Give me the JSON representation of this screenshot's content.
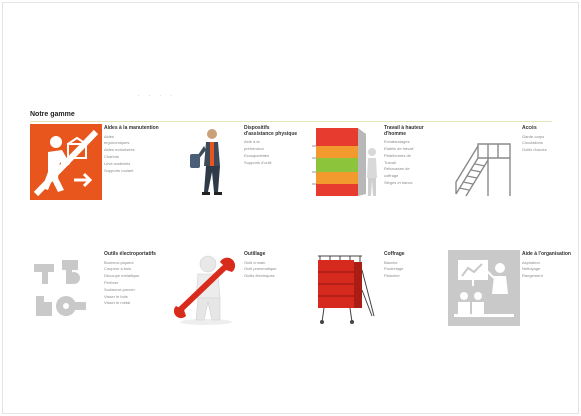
{
  "heading": "Notre gamme",
  "dots": ". . . .",
  "colors": {
    "accent": "#e8561e",
    "rule": "#e3e6b8",
    "grey_tile": "#c9c9c9"
  },
  "categories": [
    {
      "title": "Aides à la manutention",
      "icon": "porter-carrying-box-icon",
      "links": [
        "Aides",
        "ergonomiques",
        "Aides motorisées",
        "Chariots",
        "Lève-matériels",
        "Supports roulant"
      ]
    },
    {
      "title": "Dispositifs d'assistance physique",
      "icon": "worker-exoskeleton-icon",
      "links": [
        "Aide à la",
        "préhension",
        "Exosquelettes",
        "Supports d'outil"
      ]
    },
    {
      "title": "Travail à hauteur d'homme",
      "icon": "height-zones-wall-icon",
      "links": [
        "Echafaudages",
        "Etablis de travail",
        "Plateformes de",
        "Travail",
        "Réhausses de",
        "coffrage",
        "Sièges et bancs"
      ]
    },
    {
      "title": "Accès",
      "icon": "access-stairs-platform-icon",
      "links": [
        "Garde-corps",
        "Circulations",
        "Outils d'accès"
      ]
    },
    {
      "title": "Outils électroportatifs",
      "icon": "power-tools-icon",
      "links": [
        "Burineur-piqueur",
        "Coupeur à bois",
        "Découpe métallique",
        "Perforer",
        "Surfaceur-poncer",
        "Visser le bois",
        "Visser le métal"
      ]
    },
    {
      "title": "Outillage",
      "icon": "figure-with-wrench-icon",
      "links": [
        "Outil à main",
        "Outil pneumatique",
        "Outils électriques"
      ]
    },
    {
      "title": "Coffrage",
      "icon": "formwork-panel-icon",
      "links": [
        "Banche",
        "Poutrelage",
        "Plancher"
      ]
    },
    {
      "title": "Aide à l'organisation",
      "icon": "training-presentation-icon",
      "links": [
        "Aspiration",
        "Nettoyage",
        "Rangement"
      ]
    }
  ]
}
